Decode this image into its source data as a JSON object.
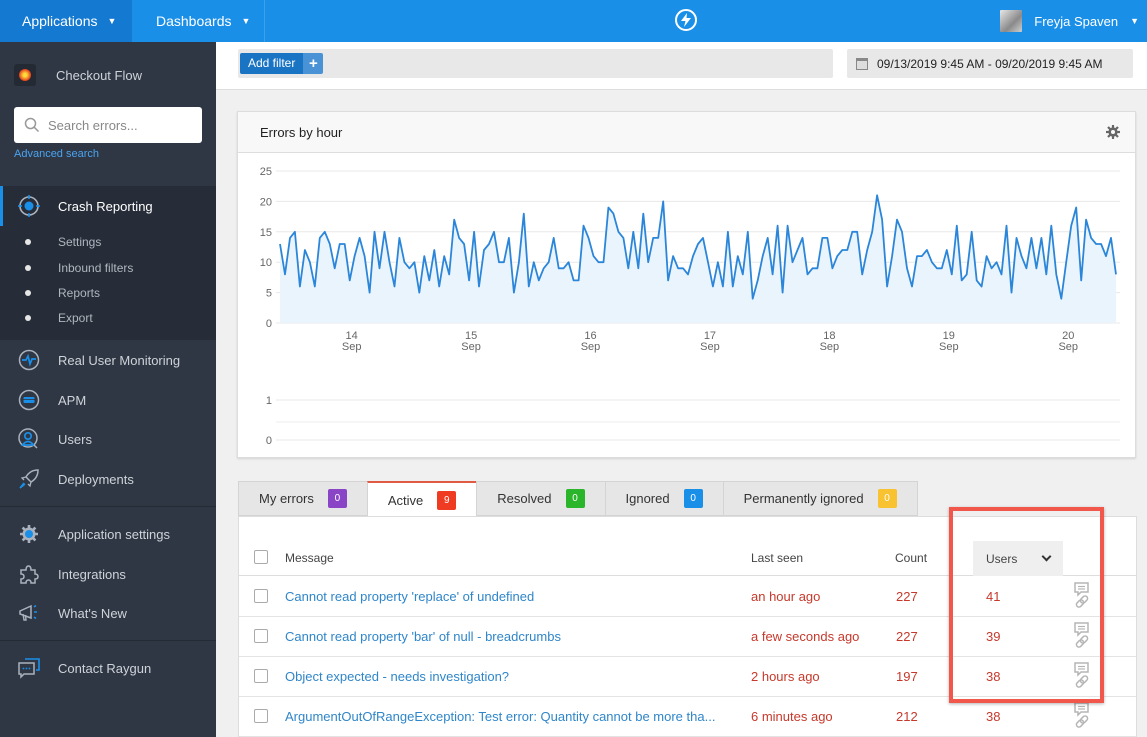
{
  "topbar": {
    "applications_label": "Applications",
    "dashboards_label": "Dashboards",
    "user_name": "Freyja Spaven"
  },
  "sidebar": {
    "app_name": "Checkout Flow",
    "search_placeholder": "Search errors...",
    "advanced_search": "Advanced search",
    "crash_reporting": "Crash Reporting",
    "crash_sub_items": [
      "Settings",
      "Inbound filters",
      "Reports",
      "Export"
    ],
    "products": [
      "Real User Monitoring",
      "APM",
      "Users",
      "Deployments"
    ],
    "settings_items": [
      "Application settings",
      "Integrations",
      "What's New"
    ],
    "contact": "Contact Raygun"
  },
  "filterbar": {
    "add_filter": "Add filter",
    "add_filter_plus": "+",
    "date_range": "09/13/2019 9:45 AM - 09/20/2019 9:45 AM"
  },
  "colors": {
    "brand_blue": "#1a8fe8",
    "line": "#2b86d9",
    "area": "#eaf4fd",
    "error_red": "#c6392b",
    "link_blue": "#2f86c9",
    "highlight": "#f2574c"
  },
  "chart_data": [
    {
      "type": "area",
      "title": "Errors by hour",
      "xlabel": "",
      "ylabel": "",
      "ylim": [
        0,
        25
      ],
      "yticks": [
        "0",
        "5",
        "10",
        "15",
        "20",
        "25"
      ],
      "xticks": [
        {
          "day": "14",
          "month": "Sep"
        },
        {
          "day": "15",
          "month": "Sep"
        },
        {
          "day": "16",
          "month": "Sep"
        },
        {
          "day": "17",
          "month": "Sep"
        },
        {
          "day": "18",
          "month": "Sep"
        },
        {
          "day": "19",
          "month": "Sep"
        },
        {
          "day": "20",
          "month": "Sep"
        }
      ],
      "grid": true,
      "x_start_day": 13.4,
      "x_end_day": 20.4,
      "series": [
        {
          "name": "Errors",
          "values": [
            13,
            8,
            14,
            15,
            6,
            12,
            10,
            6,
            14,
            15,
            13,
            9,
            13,
            13,
            7,
            11,
            14,
            11,
            5,
            15,
            9,
            15,
            10,
            6,
            14,
            10,
            9,
            10,
            5,
            11,
            7,
            12,
            6,
            11,
            8,
            17,
            14,
            13,
            7,
            15,
            6,
            12,
            13,
            15,
            10,
            10,
            14,
            5,
            10,
            18,
            6,
            10,
            7,
            9,
            10,
            14,
            9,
            9,
            10,
            7,
            7,
            16,
            14,
            11,
            10,
            10,
            19,
            18,
            15,
            14,
            9,
            15,
            9,
            18,
            10,
            14,
            14,
            20,
            7,
            11,
            9,
            9,
            8,
            11,
            13,
            14,
            10,
            6,
            10,
            6,
            15,
            6,
            11,
            8,
            15,
            4,
            7,
            11,
            14,
            8,
            16,
            5,
            16,
            10,
            12,
            14,
            8,
            9,
            9,
            14,
            14,
            9,
            11,
            12,
            12,
            15,
            15,
            8,
            12,
            15,
            21,
            17,
            6,
            11,
            17,
            15,
            9,
            6,
            11,
            11,
            12,
            10,
            9,
            9,
            12,
            8,
            16,
            7,
            8,
            15,
            7,
            6,
            11,
            9,
            10,
            8,
            16,
            5,
            14,
            11,
            9,
            14,
            9,
            14,
            8,
            16,
            8,
            4,
            10,
            16,
            19,
            7,
            17,
            14,
            13,
            13,
            11,
            14,
            8
          ]
        }
      ]
    },
    {
      "type": "line",
      "title": "",
      "ylim": [
        0,
        1
      ],
      "yticks": [
        "0",
        "1"
      ],
      "grid": true,
      "series": []
    }
  ],
  "tabs": [
    {
      "label": "My errors",
      "count": "0",
      "color": "#8a44c6"
    },
    {
      "label": "Active",
      "count": "9",
      "color": "#ee3b22",
      "active": true
    },
    {
      "label": "Resolved",
      "count": "0",
      "color": "#2bb52b"
    },
    {
      "label": "Ignored",
      "count": "0",
      "color": "#1a8fe8"
    },
    {
      "label": "Permanently ignored",
      "count": "0",
      "color": "#f8c231"
    }
  ],
  "table": {
    "headers": {
      "message": "Message",
      "last_seen": "Last seen",
      "count": "Count",
      "users": "Users"
    },
    "rows": [
      {
        "message": "Cannot read property 'replace' of undefined",
        "last_seen": "an hour ago",
        "count": "227",
        "users": "41"
      },
      {
        "message": "Cannot read property 'bar' of null - breadcrumbs",
        "last_seen": "a few seconds ago",
        "count": "227",
        "users": "39"
      },
      {
        "message": "Object expected - needs investigation?",
        "last_seen": "2 hours ago",
        "count": "197",
        "users": "38"
      },
      {
        "message": "ArgumentOutOfRangeException: Test error: Quantity cannot be more tha...",
        "last_seen": "6 minutes ago",
        "count": "212",
        "users": "38"
      }
    ]
  }
}
